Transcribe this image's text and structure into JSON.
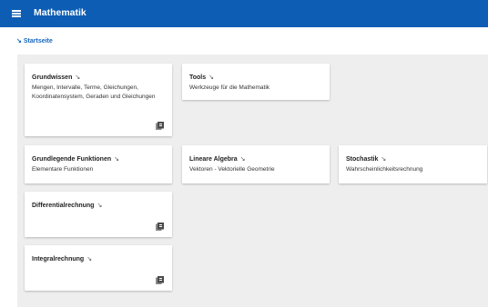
{
  "appbar": {
    "title": "Mathematik",
    "menu_icon": "hamburger-menu-icon"
  },
  "breadcrumb": {
    "arrow": "↘",
    "label": "Startseite"
  },
  "cards": [
    {
      "title": "Grundwissen",
      "arrow": "↘",
      "description": "Mengen, Intervalle, Terme, Gleichungen, Koordinatensystem, Geraden und Gleichungen",
      "icon": "book-icon"
    },
    {
      "title": "Tools",
      "arrow": "↘",
      "description": "Werkzeuge für die Mathematik"
    },
    {
      "title": "Grundlegende Funktionen",
      "arrow": "↘",
      "description": "Elementare Funktionen"
    },
    {
      "title": "Lineare Algebra",
      "arrow": "↘",
      "description": "Vektoren - Vektorielle Geometrie"
    },
    {
      "title": "Stochastik",
      "arrow": "↘",
      "description": "Wahrscheinlichkeitsrechnung"
    },
    {
      "title": "Differentialrechnung",
      "arrow": "↘",
      "description": "",
      "icon": "book-icon"
    },
    {
      "title": "Integralrechnung",
      "arrow": "↘",
      "description": "",
      "icon": "book-icon"
    }
  ],
  "colors": {
    "appbar": "#0d5db4",
    "link": "#1565c0",
    "background": "#eeeeee"
  }
}
